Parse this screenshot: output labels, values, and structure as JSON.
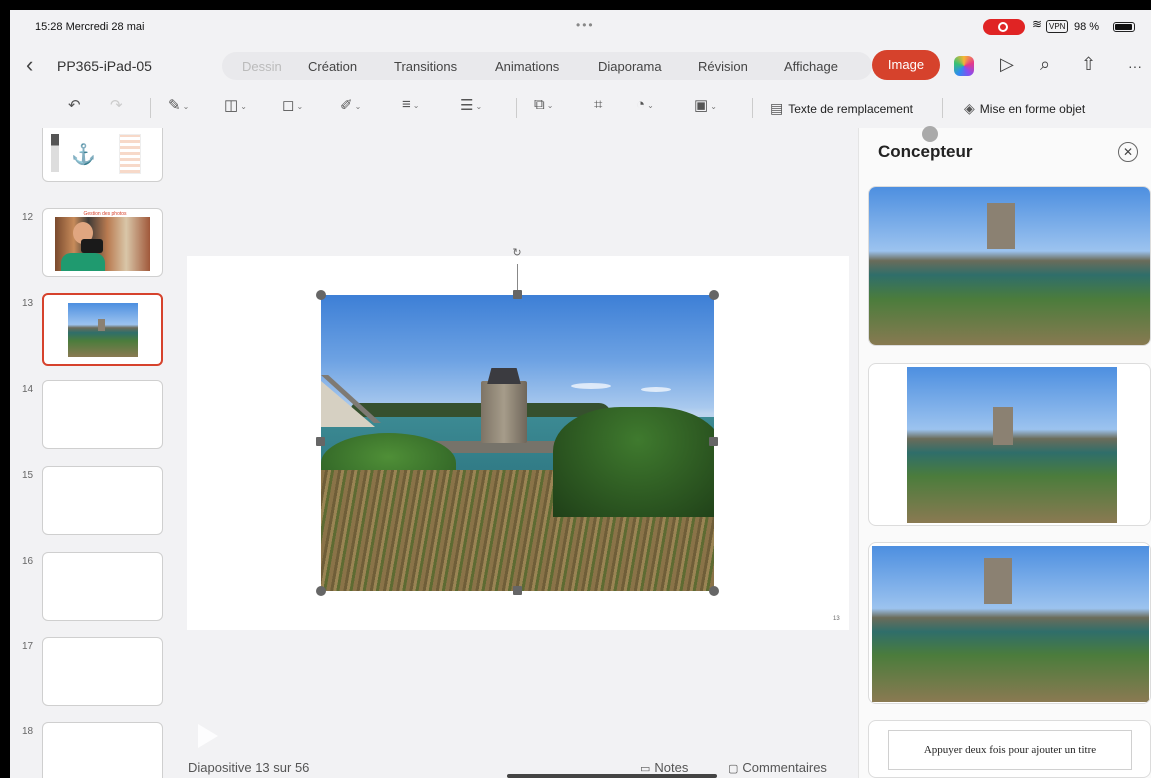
{
  "status": {
    "time_date": "15:28  Mercredi 28 mai",
    "dots": "•••",
    "vpn": "VPN",
    "battery": "98 %"
  },
  "document": {
    "name": "PP365-iPad-05"
  },
  "menu": {
    "tabs": [
      "Dessin",
      "Création",
      "Transitions",
      "Animations",
      "Diaporama",
      "Révision",
      "Affichage"
    ],
    "active_tab": "Image"
  },
  "ribbon": {
    "alt_text": "Texte de remplacement",
    "format_object": "Mise en forme objet"
  },
  "thumbnails": {
    "numbers": [
      "12",
      "13",
      "14",
      "15",
      "16",
      "17",
      "18"
    ],
    "selected": "13",
    "slide12_title": "Gestion des photos"
  },
  "slide": {
    "number_label": "13"
  },
  "footer": {
    "slide_count": "Diapositive 13 sur 56",
    "notes": "Notes",
    "comments": "Commentaires"
  },
  "designer": {
    "title": "Concepteur",
    "placeholder_title": "Appuyer deux fois pour ajouter un titre"
  },
  "colors": {
    "accent": "#d6422c",
    "background": "#f2f2f4"
  }
}
